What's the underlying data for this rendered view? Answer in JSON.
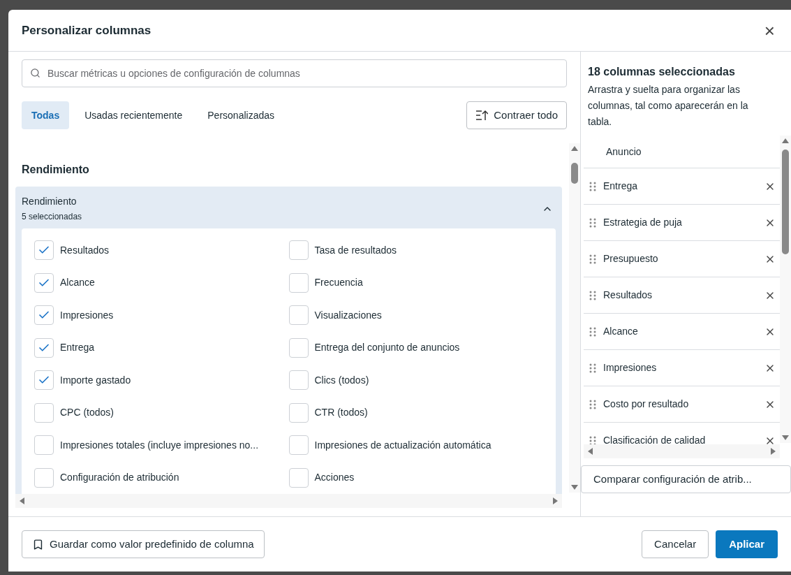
{
  "dialog": {
    "title": "Personalizar columnas",
    "close": "×"
  },
  "search": {
    "placeholder": "Buscar métricas u opciones de configuración de columnas"
  },
  "tabs": [
    {
      "label": "Todas",
      "selected": true
    },
    {
      "label": "Usadas recientemente",
      "selected": false
    },
    {
      "label": "Personalizadas",
      "selected": false
    }
  ],
  "collapse_button": "Contraer todo",
  "section": {
    "title": "Rendimiento",
    "group": {
      "title": "Rendimiento",
      "subtitle": "5 seleccionadas",
      "expanded": true,
      "options": [
        {
          "label": "Resultados",
          "checked": true
        },
        {
          "label": "Tasa de resultados",
          "checked": false
        },
        {
          "label": "Alcance",
          "checked": true
        },
        {
          "label": "Frecuencia",
          "checked": false
        },
        {
          "label": "Impresiones",
          "checked": true
        },
        {
          "label": "Visualizaciones",
          "checked": false
        },
        {
          "label": "Entrega",
          "checked": true
        },
        {
          "label": "Entrega del conjunto de anuncios",
          "checked": false
        },
        {
          "label": "Importe gastado",
          "checked": true
        },
        {
          "label": "Clics (todos)",
          "checked": false
        },
        {
          "label": "CPC (todos)",
          "checked": false
        },
        {
          "label": "CTR (todos)",
          "checked": false
        },
        {
          "label": "Impresiones totales (incluye impresiones no...",
          "checked": false
        },
        {
          "label": "Impresiones de actualización automática",
          "checked": false
        },
        {
          "label": "Configuración de atribución",
          "checked": false
        },
        {
          "label": "Acciones",
          "checked": false
        }
      ]
    }
  },
  "selected_panel": {
    "title": "18 columnas seleccionadas",
    "description": "Arrastra y suelta para organizar las columnas, tal como aparecerán en la tabla.",
    "columns": [
      {
        "label": "Anuncio",
        "removable": false
      },
      {
        "label": "Entrega",
        "removable": true
      },
      {
        "label": "Estrategia de puja",
        "removable": true
      },
      {
        "label": "Presupuesto",
        "removable": true
      },
      {
        "label": "Resultados",
        "removable": true
      },
      {
        "label": "Alcance",
        "removable": true
      },
      {
        "label": "Impresiones",
        "removable": true
      },
      {
        "label": "Costo por resultado",
        "removable": true
      },
      {
        "label": "Clasificación de calidad",
        "removable": true
      }
    ],
    "compare_button": "Comparar configuración de atrib..."
  },
  "footer": {
    "save_preset": "Guardar como valor predefinido de columna",
    "cancel": "Cancelar",
    "apply": "Aplicar"
  }
}
